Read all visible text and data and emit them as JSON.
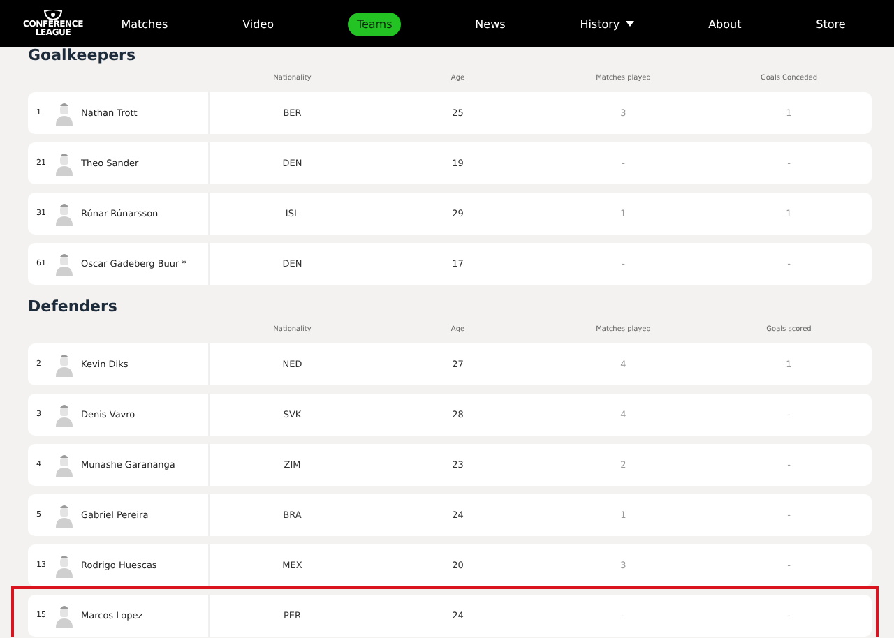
{
  "nav": {
    "logo": [
      "CONFERENCE",
      "LEAGUE"
    ],
    "items": [
      {
        "label": "Matches",
        "selected": false,
        "dropdown": false
      },
      {
        "label": "Video",
        "selected": false,
        "dropdown": false
      },
      {
        "label": "Teams",
        "selected": true,
        "dropdown": false
      },
      {
        "label": "News",
        "selected": false,
        "dropdown": false
      },
      {
        "label": "History",
        "selected": false,
        "dropdown": true
      },
      {
        "label": "About",
        "selected": false,
        "dropdown": false
      },
      {
        "label": "Store",
        "selected": false,
        "dropdown": false
      }
    ]
  },
  "sections": [
    {
      "title": "Goalkeepers",
      "columns": [
        "Nationality",
        "Age",
        "Matches played",
        "Goals Conceded"
      ],
      "players": [
        {
          "number": "1",
          "name": "Nathan Trott",
          "nationality": "BER",
          "age": "25",
          "matches": "3",
          "goals": "1",
          "highlighted": false
        },
        {
          "number": "21",
          "name": "Theo Sander",
          "nationality": "DEN",
          "age": "19",
          "matches": "-",
          "goals": "-",
          "highlighted": false
        },
        {
          "number": "31",
          "name": "Rúnar Rúnarsson",
          "nationality": "ISL",
          "age": "29",
          "matches": "1",
          "goals": "1",
          "highlighted": false
        },
        {
          "number": "61",
          "name": "Oscar Gadeberg Buur *",
          "nationality": "DEN",
          "age": "17",
          "matches": "-",
          "goals": "-",
          "highlighted": false
        }
      ]
    },
    {
      "title": "Defenders",
      "columns": [
        "Nationality",
        "Age",
        "Matches played",
        "Goals scored"
      ],
      "players": [
        {
          "number": "2",
          "name": "Kevin Diks",
          "nationality": "NED",
          "age": "27",
          "matches": "4",
          "goals": "1",
          "highlighted": false
        },
        {
          "number": "3",
          "name": "Denis Vavro",
          "nationality": "SVK",
          "age": "28",
          "matches": "4",
          "goals": "-",
          "highlighted": false
        },
        {
          "number": "4",
          "name": "Munashe Garananga",
          "nationality": "ZIM",
          "age": "23",
          "matches": "2",
          "goals": "-",
          "highlighted": false
        },
        {
          "number": "5",
          "name": "Gabriel Pereira",
          "nationality": "BRA",
          "age": "24",
          "matches": "1",
          "goals": "-",
          "highlighted": false
        },
        {
          "number": "13",
          "name": "Rodrigo Huescas",
          "nationality": "MEX",
          "age": "20",
          "matches": "3",
          "goals": "-",
          "highlighted": false
        },
        {
          "number": "15",
          "name": "Marcos Lopez",
          "nationality": "PER",
          "age": "24",
          "matches": "-",
          "goals": "-",
          "highlighted": true
        }
      ]
    }
  ]
}
